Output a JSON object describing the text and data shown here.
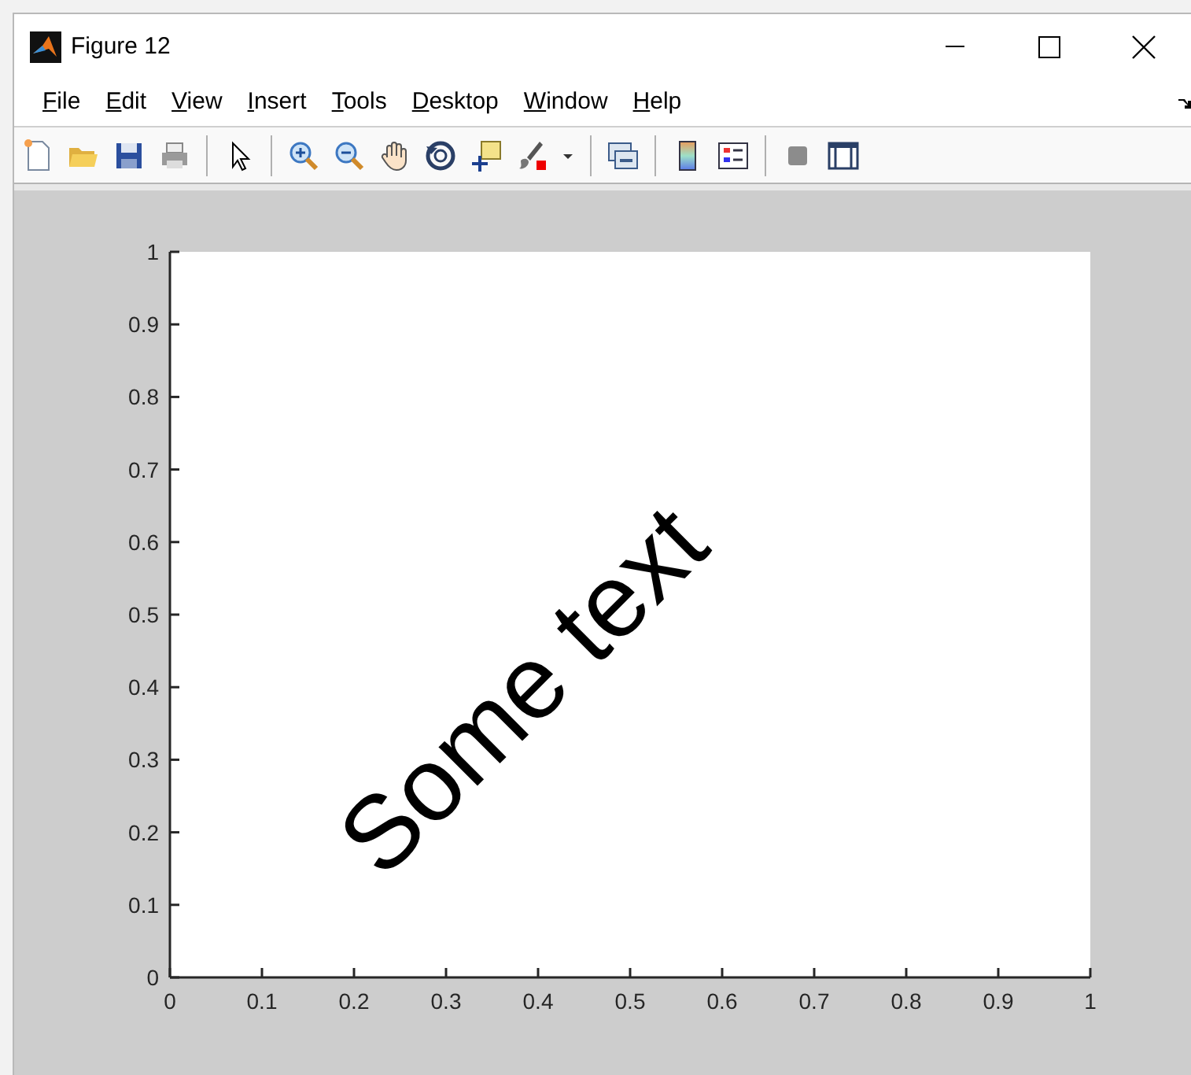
{
  "window": {
    "title": "Figure 12"
  },
  "menu": [
    {
      "label": "File"
    },
    {
      "label": "Edit"
    },
    {
      "label": "View"
    },
    {
      "label": "Insert"
    },
    {
      "label": "Tools"
    },
    {
      "label": "Desktop"
    },
    {
      "label": "Window"
    },
    {
      "label": "Help"
    }
  ],
  "axes": {
    "chart_data": {
      "type": "line",
      "xlim": [
        0,
        1
      ],
      "ylim": [
        0,
        1
      ],
      "xticks": [
        0,
        0.1,
        0.2,
        0.3,
        0.4,
        0.5,
        0.6,
        0.7,
        0.8,
        0.9,
        1
      ],
      "yticks": [
        0,
        0.1,
        0.2,
        0.3,
        0.4,
        0.5,
        0.6,
        0.7,
        0.8,
        0.9,
        1
      ],
      "annotations": [
        "Some text"
      ]
    }
  }
}
